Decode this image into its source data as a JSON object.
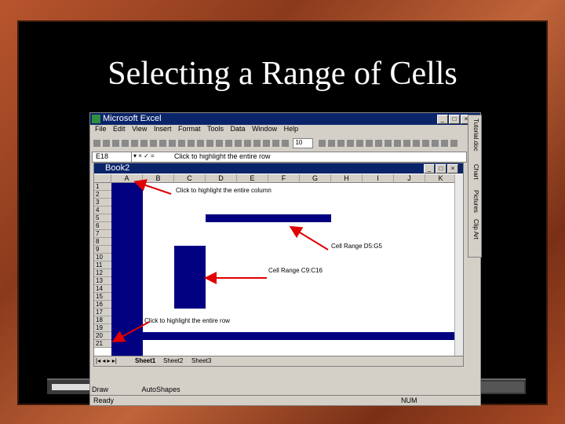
{
  "slide": {
    "title": "Selecting a Range of Cells"
  },
  "excel": {
    "window_title": "Microsoft Excel",
    "menu": [
      "File",
      "Edit",
      "View",
      "Insert",
      "Format",
      "Tools",
      "Data",
      "Window",
      "Help"
    ],
    "font_size": "10",
    "name_box": "E18",
    "formula_content": "Click to highlight the entire row",
    "book_title": "Book2",
    "columns": [
      "A",
      "B",
      "C",
      "D",
      "E",
      "F",
      "G",
      "H",
      "I",
      "J",
      "K"
    ],
    "rows": [
      "1",
      "2",
      "3",
      "4",
      "5",
      "6",
      "7",
      "8",
      "9",
      "10",
      "11",
      "12",
      "13",
      "14",
      "15",
      "16",
      "17",
      "18",
      "19",
      "20",
      "21"
    ],
    "annotations": {
      "column": "Click to highlight the entire column",
      "range1": "Cell Range D5:G5",
      "range2": "Cell Range C9:C16",
      "row": "Click to highlight the entire row"
    },
    "sheet_tabs": [
      "Sheet1",
      "Sheet2",
      "Sheet3"
    ],
    "draw_label": "Draw",
    "autoshapes_label": "AutoShapes",
    "status_left": "Ready",
    "status_num": "NUM"
  },
  "side_tabs": [
    "Tutorial.doc",
    "Chart",
    "Pictures",
    "Clip Art"
  ],
  "colors": {
    "selection": "#000080",
    "titlebar": "#0a246a",
    "arrow": "#e00000"
  }
}
